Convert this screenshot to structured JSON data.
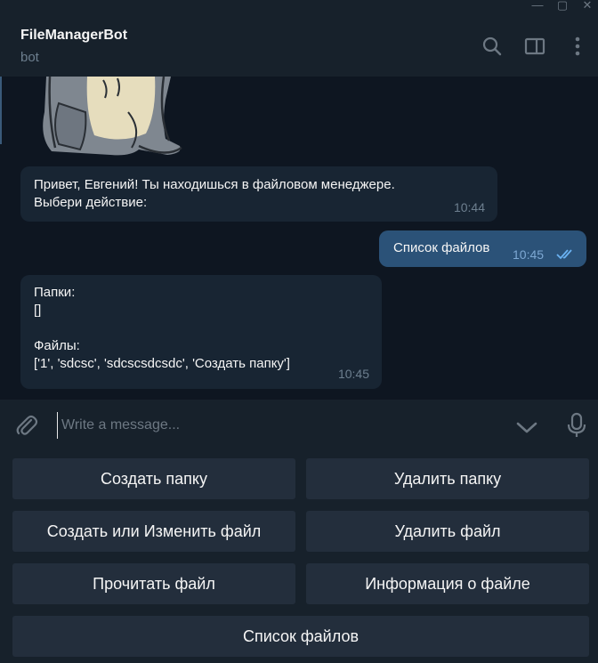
{
  "window": {
    "minimize_glyph": "—",
    "maximize_glyph": "▢",
    "close_glyph": "✕"
  },
  "header": {
    "title": "FileManagerBot",
    "subtitle": "bot",
    "icons": [
      "search-icon",
      "sidebar-toggle-icon",
      "more-vertical-icon"
    ]
  },
  "messages": [
    {
      "direction": "incoming",
      "text": "Привет, Евгений! Ты находишься в файловом менеджере.\nВыбери действие:",
      "time": "10:44"
    },
    {
      "direction": "outgoing",
      "text": "Список файлов",
      "time": "10:45",
      "status": "read"
    },
    {
      "direction": "incoming",
      "text": "Папки:\n[]\n\nФайлы:\n['1', 'sdcsc', 'sdcscsdcsdc', 'Создать папку']",
      "time": "10:45"
    }
  ],
  "composer": {
    "placeholder": "Write a message...",
    "icons": [
      "paperclip-icon",
      "chevron-down-icon",
      "microphone-icon"
    ]
  },
  "keyboard": {
    "buttons": [
      "Создать папку",
      "Удалить папку",
      "Создать или Изменить файл",
      "Удалить файл",
      "Прочитать файл",
      "Информация о файле",
      "Список файлов"
    ]
  },
  "colors": {
    "background": "#0e1621",
    "panel": "#17212b",
    "incoming_bubble": "#182533",
    "outgoing_bubble": "#2b5278",
    "keyboard_button": "#232e3c",
    "read_checks": "#6ab2f2"
  }
}
